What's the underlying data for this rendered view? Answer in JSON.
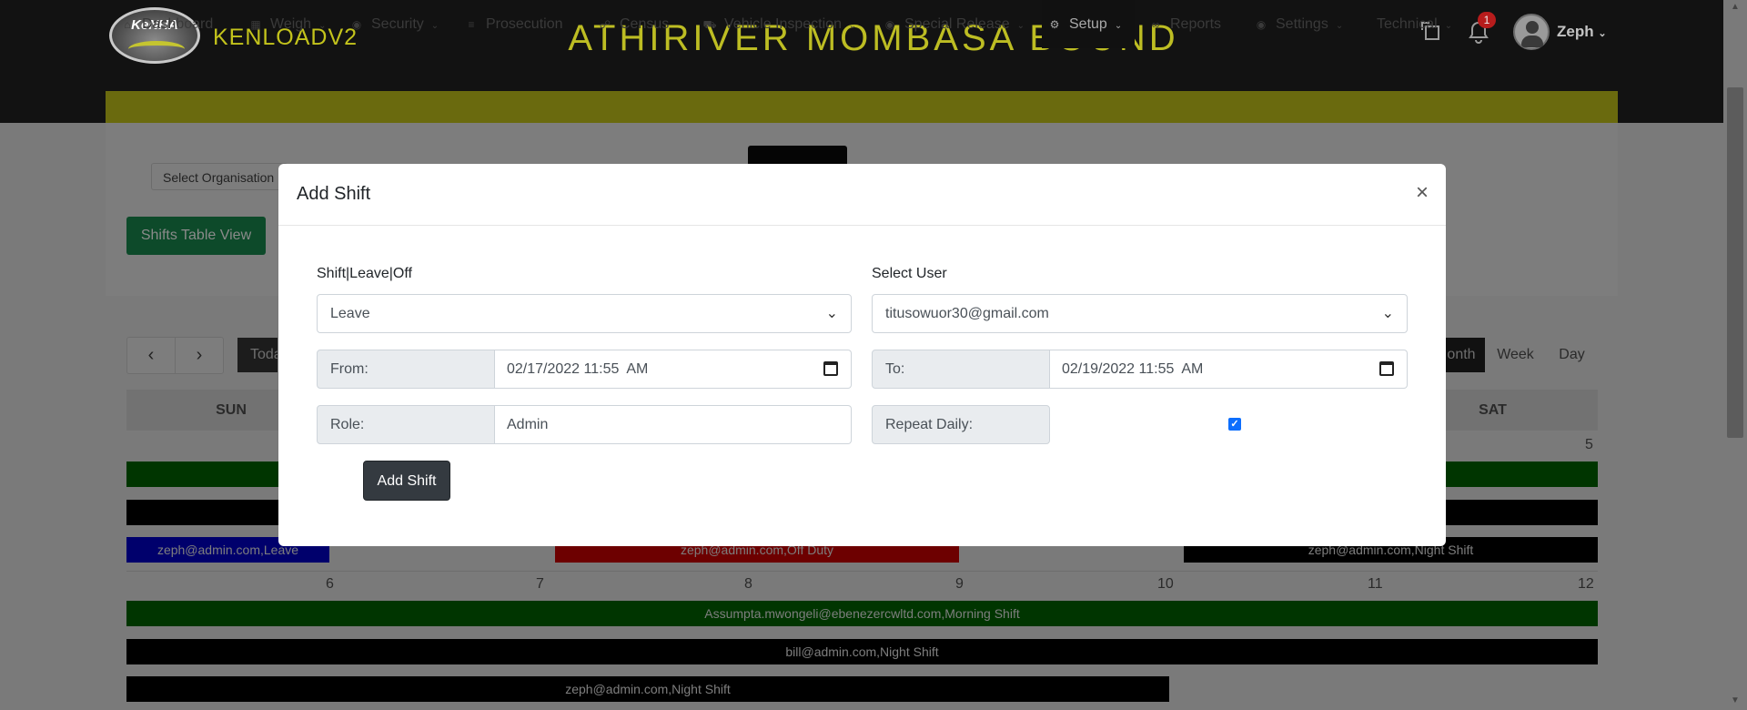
{
  "header": {
    "logo_text": "KeNHA",
    "brand": "KENLOADV2",
    "station_title": "ATHIRIVER MOMBASA BOUND",
    "notification_count": "1",
    "user_name": "Zeph"
  },
  "nav": {
    "items": [
      {
        "label": "Dashboard",
        "icon": "home-icon"
      },
      {
        "label": "Weigh",
        "icon": "scale-icon"
      },
      {
        "label": "Security",
        "icon": "lock-icon"
      },
      {
        "label": "Prosecution",
        "icon": "list-icon"
      },
      {
        "label": "Census",
        "icon": "car-icon"
      },
      {
        "label": "Vehicle Inspection",
        "icon": "truck-icon"
      },
      {
        "label": "Special Release",
        "icon": "circle-dot-icon"
      },
      {
        "label": "Setup",
        "icon": "gears-icon"
      },
      {
        "label": "Reports",
        "icon": "paperclip-icon"
      },
      {
        "label": "Settings",
        "icon": "circle-dot-icon"
      },
      {
        "label": "Technical",
        "icon": ""
      }
    ],
    "active": "Setup"
  },
  "toolbar": {
    "select_organisation": "Select Organisation",
    "shifts_table_view": "Shifts Table View"
  },
  "calendar": {
    "today_label": "Toda",
    "month_label": "onth",
    "week_label": "Week",
    "day_label": "Day",
    "weekdays": {
      "sun": "SUN",
      "sat": "SAT"
    },
    "week1_day": "5",
    "week2_days": [
      "6",
      "7",
      "8",
      "9",
      "10",
      "11",
      "12"
    ],
    "events_week1": [
      {
        "label": "zeph@admin.com,Leave",
        "color": "#0000ff"
      },
      {
        "label": "zeph@admin.com,Off Duty",
        "color": "#dd0000"
      },
      {
        "label": "zeph@admin.com,Night Shift",
        "color": "#000000"
      }
    ],
    "events_week2": [
      {
        "label": "Assumpta.mwongeli@ebenezercwltd.com,Morning Shift",
        "color": "#006400"
      },
      {
        "label": "bill@admin.com,Night Shift",
        "color": "#000000"
      },
      {
        "label": "zeph@admin.com,Night Shift",
        "color": "#000000"
      }
    ]
  },
  "modal": {
    "title": "Add Shift",
    "close": "×",
    "type_label": "Shift|Leave|Off",
    "type_value": "Leave",
    "user_label": "Select User",
    "user_value": "titusowuor30@gmail.com",
    "from_label": "From:",
    "from_value": "02/17/2022 11:55  AM",
    "to_label": "To:",
    "to_value": "02/19/2022 11:55  AM",
    "role_label": "Role:",
    "role_value": "Admin",
    "repeat_label": "Repeat Daily:",
    "repeat_checked": true,
    "submit_label": "Add Shift"
  }
}
